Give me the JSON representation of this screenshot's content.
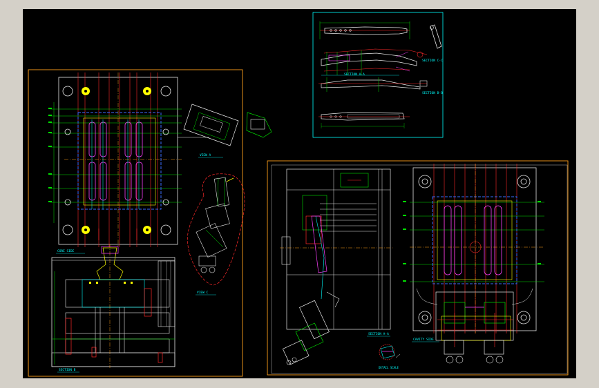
{
  "colors": {
    "background": "#000000",
    "frame": "#d4d0c8",
    "sheet_border": "#ff9f1a",
    "detail_border": "#00ffff",
    "accent_red": "#ff2a2a",
    "accent_green": "#00e000",
    "accent_cyan": "#00ffff",
    "accent_magenta": "#ff40ff",
    "accent_yellow": "#ffff00",
    "accent_blue": "#3a6bff",
    "accent_white": "#e8e8e8"
  },
  "labels": {
    "section_cc": "SECTION C-C",
    "section_aa": "SECTION A-A",
    "section_bb": "SECTION B-B",
    "view_left_core": "CORE SIDE",
    "view_right_cavity": "CAVITY SIDE",
    "view_left_slider": "VIEW A",
    "view_left_detail": "VIEW C",
    "view_left_section": "SECTION B",
    "view_right_section": "SECTION A-A",
    "view_right_detail": "DETAIL SCALE"
  }
}
